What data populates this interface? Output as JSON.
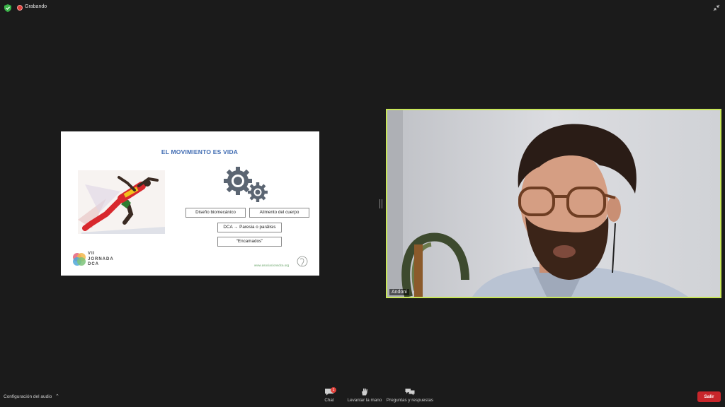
{
  "topbar": {
    "recording_label": "Grabando"
  },
  "slide": {
    "title": "EL MOVIMIENTO ES VIDA",
    "boxes": [
      "Diseño biomecánico",
      "Alimento del cuerpo",
      "DCA → Paresia o parálisis",
      "“Encamados”"
    ],
    "logo_lines": [
      "VII",
      "JORNADA",
      "DCA"
    ],
    "website": "www.asociacionsdca.org"
  },
  "video": {
    "participant_name": "Andoni",
    "active_speaker_color": "#c8e65a"
  },
  "bottombar": {
    "audio_config_label": "Configuración del audio",
    "chat_label": "Chat",
    "chat_badge": "1",
    "raise_hand_label": "Levantar la mano",
    "qa_label": "Preguntas y respuestas",
    "leave_label": "Salir",
    "leave_color": "#c8262b"
  },
  "icons": [
    "shield-icon",
    "record-icon",
    "exit-fullscreen-icon",
    "gears-icon",
    "chat-icon",
    "hand-icon",
    "qa-icon",
    "chevron-up-icon"
  ]
}
